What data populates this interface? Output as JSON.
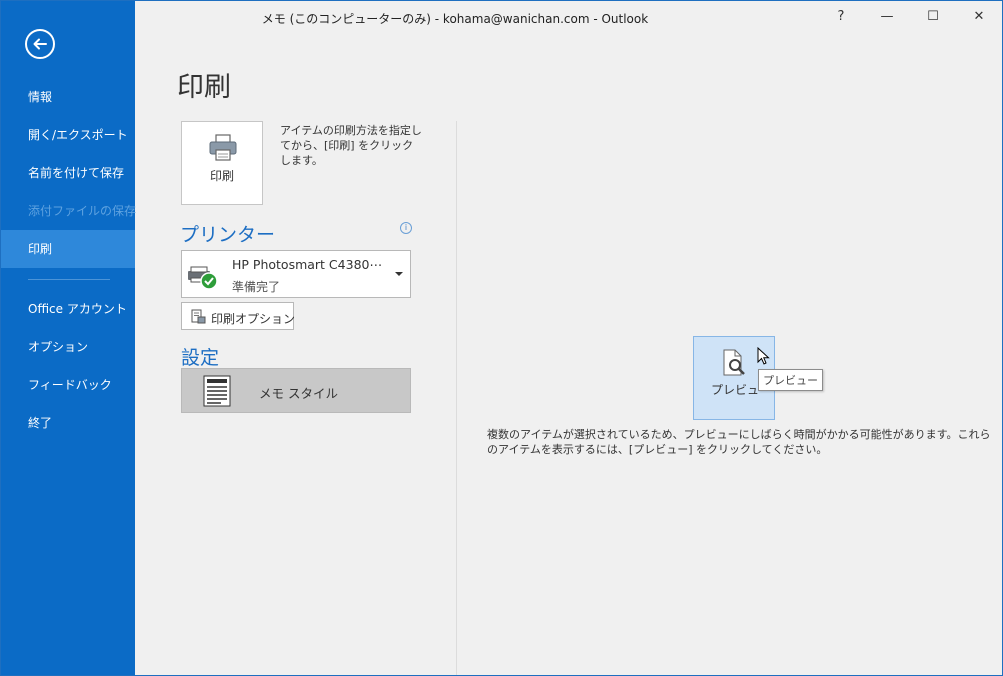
{
  "window": {
    "title": "メモ (このコンピューターのみ) - kohama@wanichan.com - Outlook",
    "help_label": "?",
    "minimize_label": "—",
    "maximize_label": "☐",
    "close_label": "✕"
  },
  "sidebar": {
    "items": [
      {
        "label": "情報"
      },
      {
        "label": "開く/エクスポート"
      },
      {
        "label": "名前を付けて保存"
      },
      {
        "label": "添付ファイルの保存"
      },
      {
        "label": "印刷"
      },
      {
        "label": "Office アカウント"
      },
      {
        "label": "オプション"
      },
      {
        "label": "フィードバック"
      },
      {
        "label": "終了"
      }
    ]
  },
  "main": {
    "page_title": "印刷",
    "print_button_label": "印刷",
    "print_description": "アイテムの印刷方法を指定してから、[印刷] をクリックします。",
    "printer_heading": "プリンター",
    "printer_info_icon": "i",
    "printer_name": "HP Photosmart C4380⋯",
    "printer_status": "準備完了",
    "print_options_label": "印刷オプション",
    "settings_heading": "設定",
    "style_label": "メモ スタイル",
    "preview_button_label": "プレビュー",
    "preview_tooltip": "プレビュー",
    "preview_message": "複数のアイテムが選択されているため、プレビューにしばらく時間がかかる可能性があります。これらのアイテムを表示するには、[プレビュー] をクリックしてください。"
  },
  "colors": {
    "sidebar_bg": "#0b6bc6",
    "sidebar_active": "#2e88da",
    "accent_heading": "#1d6ec3"
  },
  "icons": {
    "back": "back-arrow-icon",
    "printer": "printer-icon",
    "printer_ready": "printer-ready-icon",
    "print_options": "print-options-icon",
    "memo_style": "memo-style-icon",
    "preview": "preview-magnifier-icon"
  }
}
